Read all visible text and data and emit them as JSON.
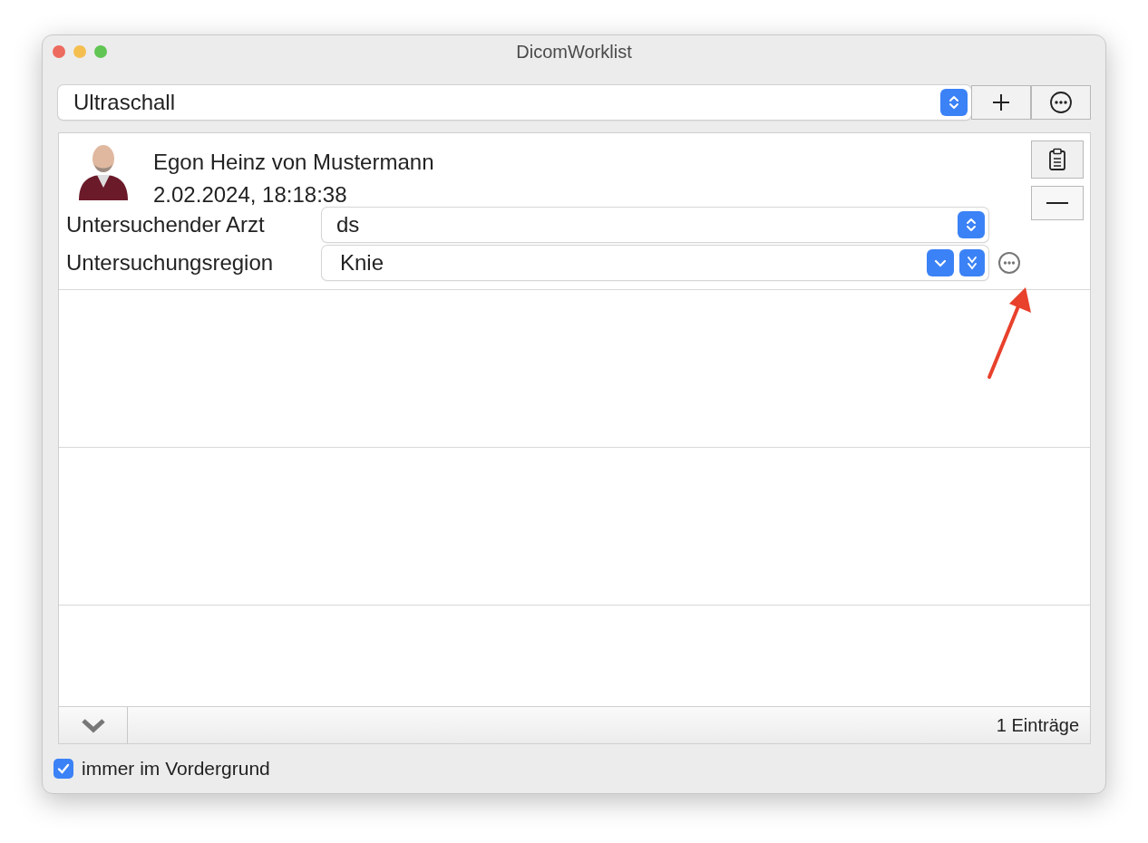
{
  "window": {
    "title": "DicomWorklist"
  },
  "worklist_selector": {
    "value": "Ultraschall"
  },
  "entries": [
    {
      "patient_name": "Egon Heinz von Mustermann",
      "datetime": "2.02.2024, 18:18:38",
      "fields": [
        {
          "label": "Untersuchender Arzt",
          "value": "ds",
          "kind": "popup"
        },
        {
          "label": "Untersuchungsregion",
          "value": "Knie",
          "kind": "combo"
        }
      ]
    }
  ],
  "footer": {
    "count": "1 Einträge"
  },
  "always_on_top": {
    "label": "immer im Vordergrund",
    "checked": true
  }
}
